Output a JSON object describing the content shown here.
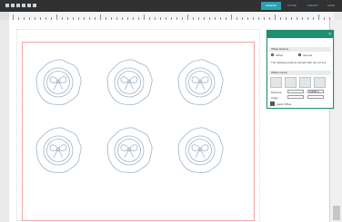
{
  "app": {
    "tabs": [
      "DESIGN",
      "STORE",
      "LIBRARY",
      "SEND"
    ],
    "active_tab": 0,
    "accent": "#2aa1b3"
  },
  "canvas": {
    "mat_border_color": "#f2a4a8",
    "seal_stroke": "#9fb4c8",
    "items": [
      {
        "name": "wax-seal-1"
      },
      {
        "name": "wax-seal-2"
      },
      {
        "name": "wax-seal-3"
      },
      {
        "name": "wax-seal-4"
      },
      {
        "name": "wax-seal-5"
      },
      {
        "name": "wax-seal-6"
      }
    ]
  },
  "panel": {
    "header_color": "#1f8f6f",
    "title": "Offset Options",
    "mode_label": "Offset",
    "internal_label": "Internal",
    "note": "The following options interact with the cut line",
    "corner_section": "Offset Corner",
    "distance_label": "Distance",
    "distance_value": "0.035 in",
    "angle_label": "Angle",
    "apply_label": "Apply Offset"
  }
}
